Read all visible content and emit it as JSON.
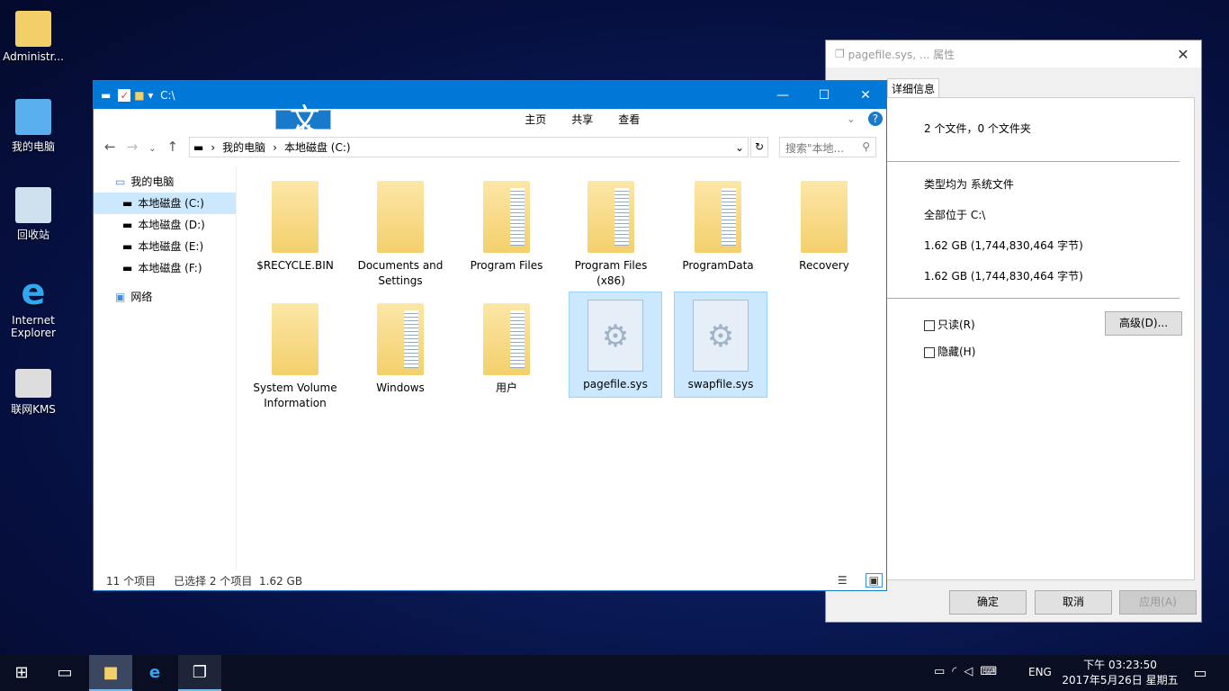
{
  "desktop": {
    "icons": [
      {
        "label": "Administr..."
      },
      {
        "label": "我的电脑"
      },
      {
        "label": "回收站"
      },
      {
        "label": "Internet Explorer"
      },
      {
        "label": "联网KMS"
      }
    ]
  },
  "properties": {
    "title": "pagefile.sys, ... 属性",
    "tab_details": "详细信息",
    "summary": "2 个文件，0 个文件夹",
    "type": "类型均为 系统文件",
    "location": "全部位于 C:\\",
    "size": "1.62 GB (1,744,830,464 字节)",
    "size_on_disk": "1.62 GB (1,744,830,464 字节)",
    "readonly": "只读(R)",
    "hidden": "隐藏(H)",
    "advanced": "高级(D)...",
    "ok": "确定",
    "cancel": "取消",
    "apply": "应用(A)"
  },
  "explorer": {
    "title": "C:\\",
    "ribbon": [
      "文件",
      "主页",
      "共享",
      "查看"
    ],
    "breadcrumb": [
      "我的电脑",
      "本地磁盘 (C:)"
    ],
    "search_placeholder": "搜索\"本地...",
    "nav": [
      {
        "label": "我的电脑"
      },
      {
        "label": "本地磁盘 (C:)",
        "selected": true
      },
      {
        "label": "本地磁盘 (D:)"
      },
      {
        "label": "本地磁盘 (E:)"
      },
      {
        "label": "本地磁盘 (F:)"
      },
      {
        "label": "网络"
      }
    ],
    "items": [
      {
        "name": "$RECYCLE.BIN",
        "type": "folder"
      },
      {
        "name": "Documents and Settings",
        "type": "folder"
      },
      {
        "name": "Program Files",
        "type": "folder"
      },
      {
        "name": "Program Files (x86)",
        "type": "folder"
      },
      {
        "name": "ProgramData",
        "type": "folder"
      },
      {
        "name": "Recovery",
        "type": "folder"
      },
      {
        "name": "System Volume Information",
        "type": "folder"
      },
      {
        "name": "Windows",
        "type": "folder"
      },
      {
        "name": "用户",
        "type": "folder"
      },
      {
        "name": "pagefile.sys",
        "type": "file",
        "selected": true
      },
      {
        "name": "swapfile.sys",
        "type": "file",
        "selected": true
      }
    ],
    "status": {
      "count": "11 个项目",
      "selection": "已选择 2 个项目",
      "size": "1.62 GB"
    }
  },
  "taskbar": {
    "lang": "ENG",
    "time": "下午 03:23:50",
    "date": "2017年5月26日 星期五"
  }
}
